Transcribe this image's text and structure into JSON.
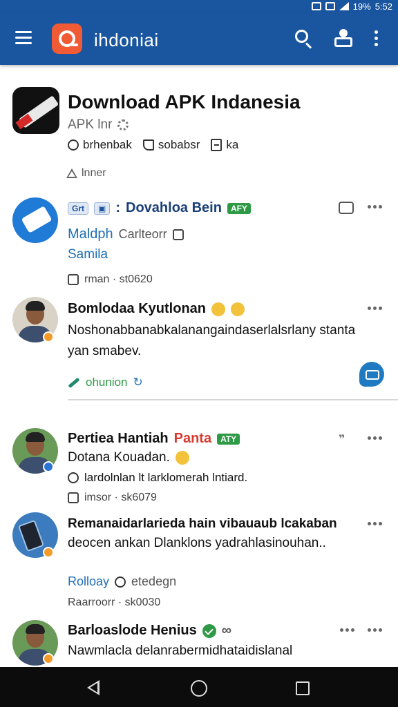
{
  "status": {
    "battery": "19%",
    "time": "5:52"
  },
  "appbar": {
    "title": "ihdoniai"
  },
  "app": {
    "name": "Download APK Indanesia",
    "subtitle": "APK lnr",
    "meta": [
      "brhenbak",
      "sobabsr",
      "ka"
    ],
    "warning": "lnner"
  },
  "posts": [
    {
      "title": "Dovahloa Bein",
      "tags": [
        "Grt",
        "▣"
      ],
      "badge": "AFY",
      "line1": "Maldph",
      "line1_sub": "Carlteorr",
      "line2": "Samila",
      "meta": "rman · st0620"
    },
    {
      "title": "Bomlodaa Kyutlonan",
      "body": "Noshonabbanabkalanangaindaserlalsrlany stanta yan smabev.",
      "action": "ohunion"
    },
    {
      "title": "Pertiea Hantiah",
      "title_extra": "Panta",
      "badge": "ATY",
      "line1": "Dotana Kouadan.",
      "line2": "lardolnlan lt larklomerah lntiard.",
      "meta": "imsor · sk6079"
    },
    {
      "title": "Remanaidarlarieda hain vibauaub lcakaban",
      "title2": "deocen ankan Dlanklons yadrahlasinouhan..",
      "line1": "Rolloay",
      "line1_sub": "etedegn",
      "meta": "Raarroorr · sk0030"
    },
    {
      "title": "Barloaslode Henius",
      "body": "Nawmlacla delanrabermidhataidislanal"
    }
  ],
  "colors": {
    "primary": "#1a56a0",
    "accent": "#f05a34",
    "green": "#2e9a45"
  }
}
